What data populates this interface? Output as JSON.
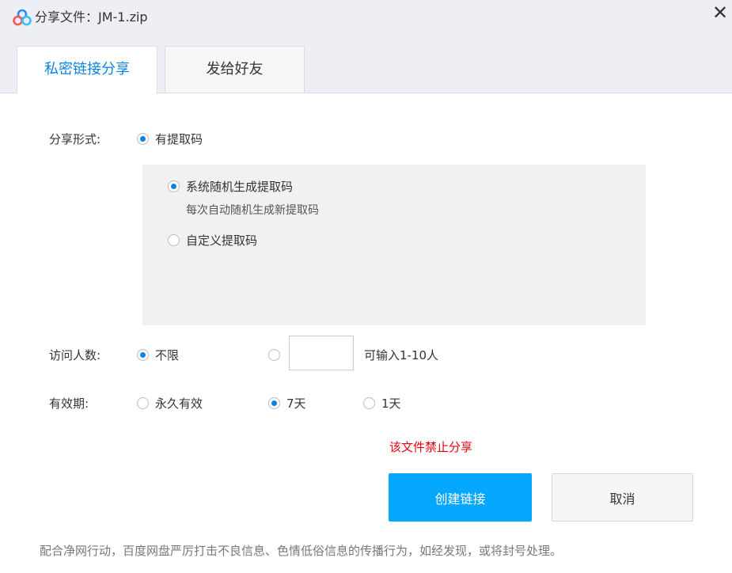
{
  "window": {
    "title": "分享文件：JM-1.zip",
    "close_symbol": "✕",
    "logo_icon": "baidu-netdisk-logo-icon"
  },
  "tabs": [
    {
      "label": "私密链接分享",
      "active": true
    },
    {
      "label": "发给好友",
      "active": false
    }
  ],
  "share_form": {
    "label": "分享形式:",
    "option": "有提取码",
    "selected": true
  },
  "extraction_code": {
    "random_label": "系统随机生成提取码",
    "random_hint": "每次自动随机生成新提取码",
    "random_selected": true,
    "custom_label": "自定义提取码",
    "custom_selected": false
  },
  "visitors": {
    "label": "访问人数:",
    "unlimited_label": "不限",
    "unlimited_selected": true,
    "custom_selected": false,
    "count_value": "",
    "hint": "可输入1-10人"
  },
  "validity": {
    "label": "有效期:",
    "options": [
      {
        "label": "永久有效",
        "selected": false
      },
      {
        "label": "7天",
        "selected": true
      },
      {
        "label": "1天",
        "selected": false
      }
    ]
  },
  "warning": "该文件禁止分享",
  "buttons": {
    "create": "创建链接",
    "cancel": "取消"
  },
  "footer_note": "配合净网行动，百度网盘严厉打击不良信息、色情低俗信息的传播行为，如经发现，或将封号处理。",
  "colors": {
    "accent": "#0a83e6",
    "primary_button": "#06a7ff",
    "warning": "#e60012"
  }
}
